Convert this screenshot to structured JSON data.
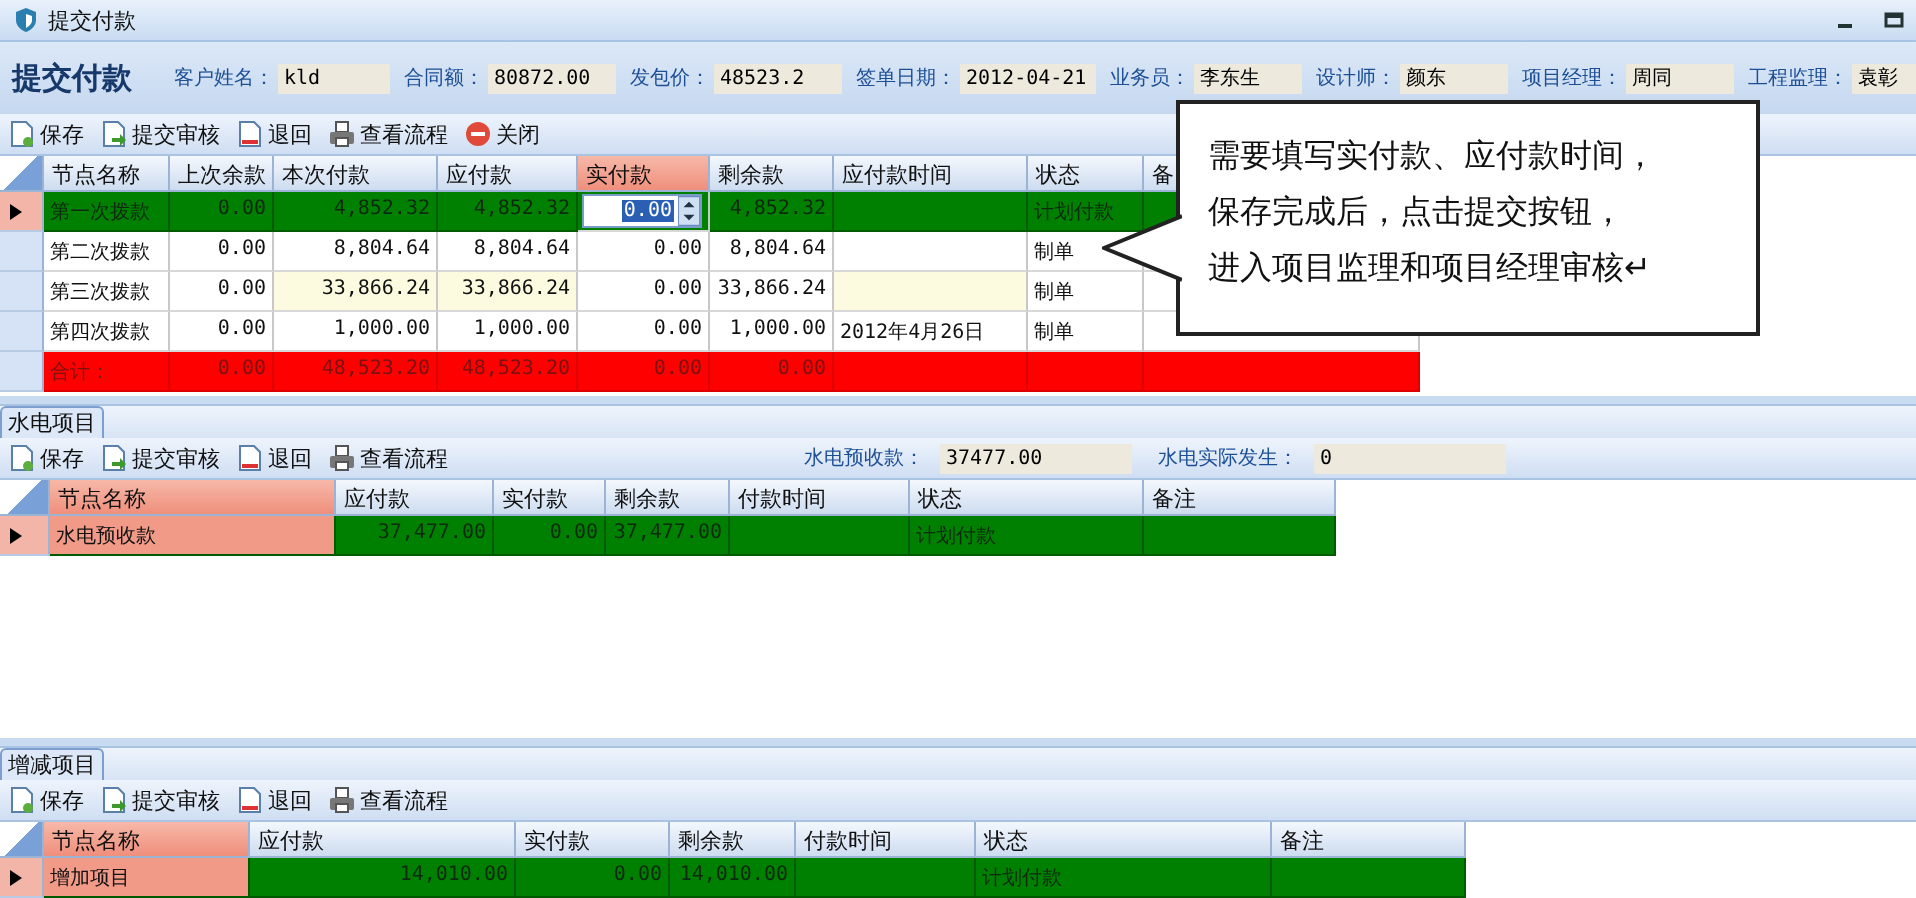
{
  "window": {
    "title": "提交付款"
  },
  "header": {
    "title": "提交付款",
    "fields": [
      {
        "label": "客户姓名：",
        "value": "kld"
      },
      {
        "label": "合同额：",
        "value": "80872.00"
      },
      {
        "label": "发包价：",
        "value": "48523.2"
      },
      {
        "label": "签单日期：",
        "value": "2012-04-21"
      },
      {
        "label": "业务员：",
        "value": "李东生"
      },
      {
        "label": "设计师：",
        "value": "颜东"
      },
      {
        "label": "项目经理：",
        "value": "周同"
      },
      {
        "label": "工程监理：",
        "value": "袁彰"
      }
    ]
  },
  "toolbar": [
    {
      "label": "保存",
      "kind": "save"
    },
    {
      "label": "提交审核",
      "kind": "submit"
    },
    {
      "label": "退回",
      "kind": "return"
    },
    {
      "label": "查看流程",
      "kind": "flow"
    },
    {
      "label": "关闭",
      "kind": "close"
    }
  ],
  "payment_grid": {
    "columns": [
      {
        "label": "节点名称",
        "kind": "text",
        "highlighted": false,
        "editable": false
      },
      {
        "label": "上次余款",
        "kind": "number",
        "highlighted": false,
        "editable": false
      },
      {
        "label": "本次付款",
        "kind": "number",
        "highlighted": false,
        "editable": true
      },
      {
        "label": "应付款",
        "kind": "number",
        "highlighted": false,
        "editable": true
      },
      {
        "label": "实付款",
        "kind": "number",
        "highlighted": true,
        "editable": false
      },
      {
        "label": "剩余款",
        "kind": "number",
        "highlighted": false,
        "editable": false
      },
      {
        "label": "应付款时间",
        "kind": "text",
        "highlighted": false,
        "editable": true
      },
      {
        "label": "状态",
        "kind": "text",
        "highlighted": false,
        "editable": false
      },
      {
        "label": "备",
        "kind": "text",
        "highlighted": false,
        "editable": false
      }
    ],
    "rows": [
      {
        "kind": "plan",
        "selected": true,
        "hovered": false,
        "cells": [
          "第一次拨款",
          "0.00",
          "4,852.32",
          "4,852.32",
          "0.00",
          "4,852.32",
          null,
          "计划付款",
          null
        ]
      },
      {
        "kind": "draft",
        "selected": false,
        "hovered": false,
        "cells": [
          "第二次拨款",
          "0.00",
          "8,804.64",
          "8,804.64",
          "0.00",
          "8,804.64",
          null,
          "制单",
          null
        ]
      },
      {
        "kind": "draft",
        "selected": false,
        "hovered": true,
        "cells": [
          "第三次拨款",
          "0.00",
          "33,866.24",
          "33,866.24",
          "0.00",
          "33,866.24",
          null,
          "制单",
          null
        ]
      },
      {
        "kind": "draft",
        "selected": false,
        "hovered": false,
        "cells": [
          "第四次拨款",
          "0.00",
          "1,000.00",
          "1,000.00",
          "0.00",
          "1,000.00",
          "2012年4月26日",
          "制单",
          null
        ]
      },
      {
        "kind": "total",
        "selected": false,
        "hovered": false,
        "cells": [
          "合计：",
          "0.00",
          "48,523.20",
          "48,523.20",
          "0.00",
          "0.00",
          null,
          null,
          null
        ]
      }
    ]
  },
  "callout": {
    "lines": [
      "需要填写实付款、应付款时间，",
      "保存完成后，点击提交按钮，",
      "进入项目监理和项目经理审核↵"
    ]
  },
  "sections": [
    {
      "tab": "水电项目",
      "toolbar": [
        {
          "label": "保存",
          "kind": "save"
        },
        {
          "label": "提交审核",
          "kind": "submit"
        },
        {
          "label": "退回",
          "kind": "return"
        },
        {
          "label": "查看流程",
          "kind": "flow"
        }
      ],
      "fields": [
        {
          "label": "水电预收款：",
          "value": "37477.00"
        },
        {
          "label": "水电实际发生：",
          "value": "0"
        }
      ],
      "grid": {
        "columns": [
          {
            "label": "节点名称",
            "kind": "text",
            "highlighted": true
          },
          {
            "label": "应付款",
            "kind": "number",
            "highlighted": false
          },
          {
            "label": "实付款",
            "kind": "number",
            "highlighted": false
          },
          {
            "label": "剩余款",
            "kind": "number",
            "highlighted": false
          },
          {
            "label": "付款时间",
            "kind": "text",
            "highlighted": false
          },
          {
            "label": "状态",
            "kind": "text",
            "highlighted": false
          },
          {
            "label": "备注",
            "kind": "text",
            "highlighted": false
          }
        ],
        "rows": [
          {
            "kind": "plan",
            "selected": true,
            "hovered": false,
            "cells": [
              "水电预收款",
              "37,477.00",
              "0.00",
              "37,477.00",
              null,
              "计划付款",
              null
            ]
          }
        ]
      }
    },
    {
      "tab": "增减项目",
      "toolbar": [
        {
          "label": "保存",
          "kind": "save"
        },
        {
          "label": "提交审核",
          "kind": "submit"
        },
        {
          "label": "退回",
          "kind": "return"
        },
        {
          "label": "查看流程",
          "kind": "flow"
        }
      ],
      "grid": {
        "columns": [
          {
            "label": "节点名称",
            "kind": "text",
            "highlighted": true
          },
          {
            "label": "应付款",
            "kind": "number",
            "highlighted": false
          },
          {
            "label": "实付款",
            "kind": "number",
            "highlighted": false
          },
          {
            "label": "剩余款",
            "kind": "number",
            "highlighted": false
          },
          {
            "label": "付款时间",
            "kind": "text",
            "highlighted": false
          },
          {
            "label": "状态",
            "kind": "text",
            "highlighted": false
          },
          {
            "label": "备注",
            "kind": "text",
            "highlighted": false
          }
        ],
        "rows": [
          {
            "kind": "plan",
            "selected": true,
            "hovered": false,
            "cells": [
              "增加项目",
              "14,010.00",
              "0.00",
              "14,010.00",
              null,
              "计划付款",
              null
            ]
          }
        ]
      }
    }
  ]
}
